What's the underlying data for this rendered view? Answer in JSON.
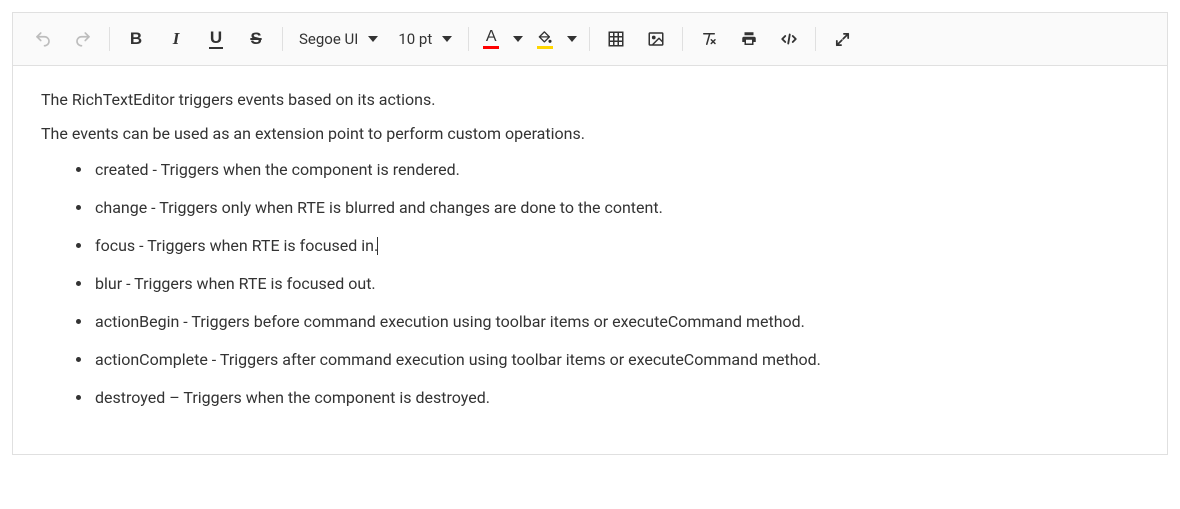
{
  "toolbar": {
    "font_name": "Segoe UI",
    "font_size": "10 pt",
    "font_color": "#ff0000",
    "bg_color": "#ffd600",
    "glyphs": {
      "bold": "B",
      "italic": "I",
      "underline": "U",
      "strike": "S",
      "font_color_letter": "A"
    }
  },
  "content": {
    "p1": "The RichTextEditor triggers events based on its actions.",
    "p2": "The events can be used as an extension point to perform custom operations.",
    "list": [
      "created - Triggers when the component is rendered.",
      "change - Triggers only when RTE is blurred and changes are done to the content.",
      "focus - Triggers when RTE is focused in.",
      "blur - Triggers when RTE is focused out.",
      "actionBegin - Triggers before command execution using toolbar items or executeCommand method.",
      "actionComplete - Triggers after command execution using toolbar items or executeCommand method.",
      "destroyed – Triggers when the component is destroyed."
    ],
    "cursor_after_list_index": 2
  }
}
